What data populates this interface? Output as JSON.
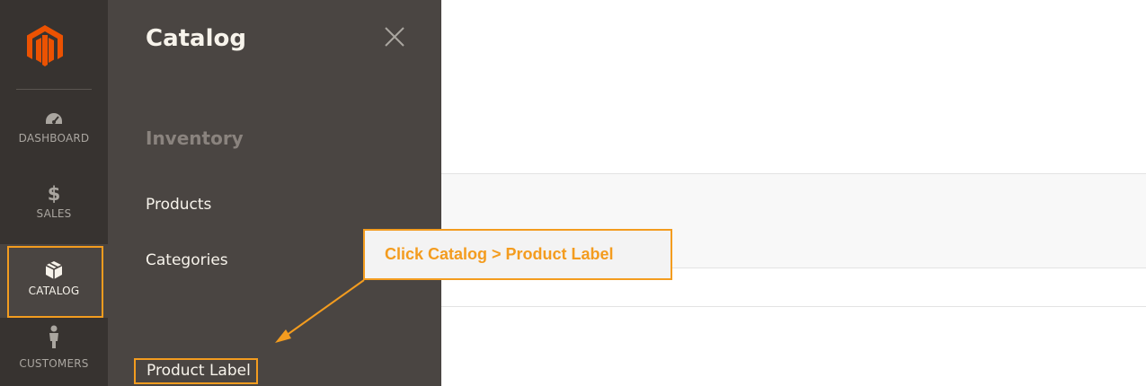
{
  "admin_nav": {
    "logo_icon": "magento-logo-icon",
    "brand_color": "#eb5202",
    "items": [
      {
        "label": "DASHBOARD",
        "icon": "speedometer-icon"
      },
      {
        "label": "SALES",
        "icon": "dollar-icon"
      },
      {
        "label": "CATALOG",
        "icon": "box-icon",
        "active": true
      },
      {
        "label": "CUSTOMERS",
        "icon": "person-icon"
      }
    ]
  },
  "flyout": {
    "title": "Catalog",
    "close_icon": "close-icon",
    "section": "Inventory",
    "links": [
      {
        "label": "Products"
      },
      {
        "label": "Categories"
      },
      {
        "label": "Product Label",
        "highlighted": true
      }
    ]
  },
  "callout": {
    "text": "Click Catalog > Product Label",
    "accent_color": "#f39c1f"
  }
}
